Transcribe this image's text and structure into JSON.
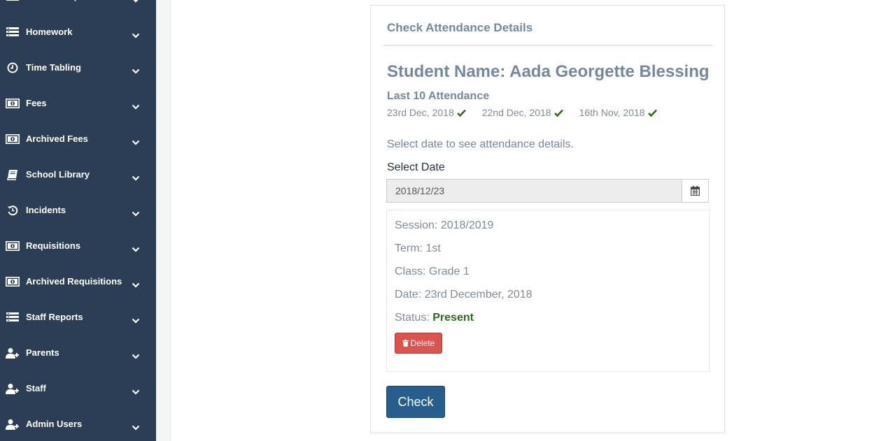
{
  "sidebar": {
    "items": [
      {
        "label": "Student Reports",
        "icon": "list-icon"
      },
      {
        "label": "Homework",
        "icon": "list-icon"
      },
      {
        "label": "Time Tabling",
        "icon": "clock-icon"
      },
      {
        "label": "Fees",
        "icon": "money-icon"
      },
      {
        "label": "Archived Fees",
        "icon": "money-icon"
      },
      {
        "label": "School Library",
        "icon": "book-icon"
      },
      {
        "label": "Incidents",
        "icon": "history-icon"
      },
      {
        "label": "Requisitions",
        "icon": "money-icon"
      },
      {
        "label": "Archived Requisitions",
        "icon": "money-icon"
      },
      {
        "label": "Staff Reports",
        "icon": "list-icon"
      },
      {
        "label": "Parents",
        "icon": "user-plus-icon"
      },
      {
        "label": "Staff",
        "icon": "user-plus-icon"
      },
      {
        "label": "Admin Users",
        "icon": "user-plus-icon"
      }
    ]
  },
  "card": {
    "title": "Check Attendance Details",
    "student_name": "Student Name: Aada Georgette Blessing",
    "last_attendance_title": "Last 10 Attendance",
    "attendance": [
      {
        "date": "23rd Dec, 2018",
        "status_icon": "check-icon"
      },
      {
        "date": "22nd Dec, 2018",
        "status_icon": "check-icon"
      },
      {
        "date": "16th Nov, 2018",
        "status_icon": "check-icon"
      }
    ],
    "hint": "Select date to see attendance details.",
    "select_date_label": "Select Date",
    "date_value": "2018/12/23",
    "details": {
      "session": "Session: 2018/2019",
      "term": "Term: 1st",
      "class": "Class: Grade 1",
      "date": "Date: 23rd December, 2018",
      "status_label": "Status: ",
      "status_value": "Present"
    },
    "delete_label": "Delete",
    "check_label": "Check"
  },
  "colors": {
    "sidebar_bg": "#2c3e55",
    "present": "#2f6b1d",
    "delete": "#d9534f",
    "check": "#285e8e"
  }
}
